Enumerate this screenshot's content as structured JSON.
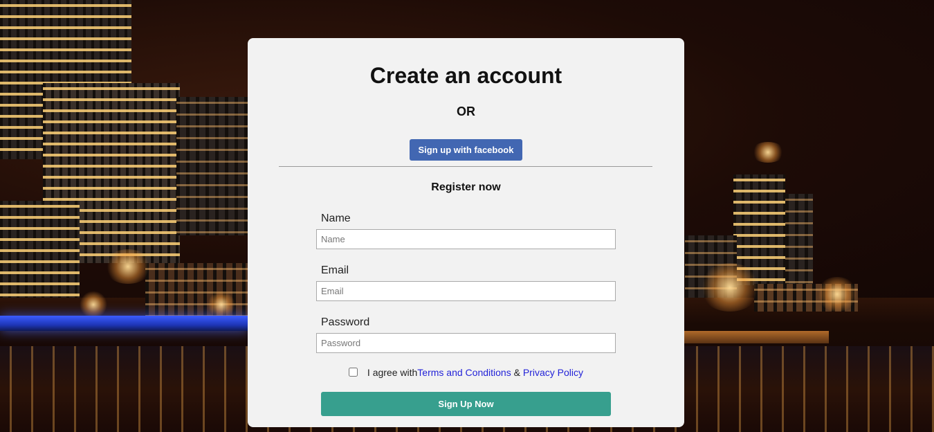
{
  "form": {
    "title": "Create an account",
    "or_text": "OR",
    "facebook_button": "Sign up with facebook",
    "register_heading": "Register now",
    "name_label": "Name",
    "name_placeholder": "Name",
    "email_label": "Email",
    "email_placeholder": "Email",
    "password_label": "Password",
    "password_placeholder": "Password",
    "agree_prefix": "I agree with",
    "terms_link": "Terms and Conditions",
    "ampersand": "&",
    "privacy_link": "Privacy Policy",
    "agree_checked": false,
    "submit_button": "Sign Up Now"
  },
  "colors": {
    "card_background": "#f2f2f2",
    "facebook_button": "#4267b2",
    "submit_button": "#379f8e",
    "link": "#2323d8"
  }
}
